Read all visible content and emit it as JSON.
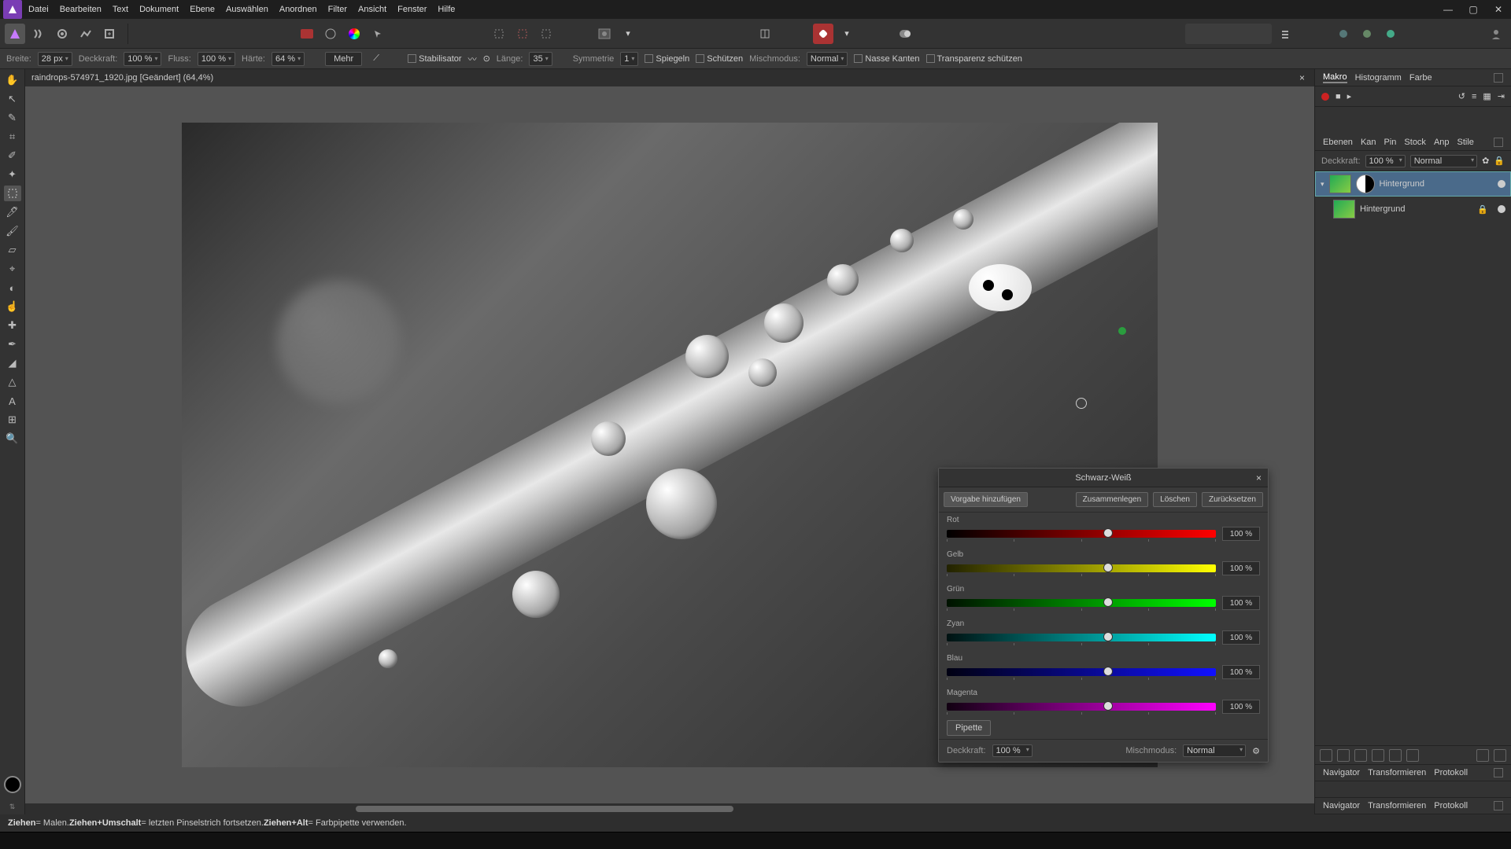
{
  "menu": [
    "Datei",
    "Bearbeiten",
    "Text",
    "Dokument",
    "Ebene",
    "Auswählen",
    "Anordnen",
    "Filter",
    "Ansicht",
    "Fenster",
    "Hilfe"
  ],
  "context": {
    "breite_lbl": "Breite:",
    "breite": "28 px",
    "deckkraft_lbl": "Deckkraft:",
    "deckkraft": "100 %",
    "fluss_lbl": "Fluss:",
    "fluss": "100 %",
    "haerte_lbl": "Härte:",
    "haerte": "64 %",
    "mehr": "Mehr",
    "stabi": "Stabilisator",
    "laenge_lbl": "Länge:",
    "laenge": "35",
    "sym_lbl": "Symmetrie",
    "sym": "1",
    "spiegeln": "Spiegeln",
    "schuetzen": "Schützen",
    "misch_lbl": "Mischmodus:",
    "misch": "Normal",
    "nasse": "Nasse Kanten",
    "trans": "Transparenz schützen"
  },
  "tab": "raindrops-574971_1920.jpg [Geändert] (64,4%)",
  "right": {
    "tabs1": [
      "Makro",
      "Histogramm",
      "Farbe"
    ],
    "tabs2": [
      "Ebenen",
      "Kan",
      "Pin",
      "Stock",
      "Anp",
      "Stile"
    ],
    "deck_lbl": "Deckkraft:",
    "deck": "100 %",
    "blend": "Normal",
    "layer1": "Hintergrund",
    "layer2": "Hintergrund",
    "tabs3": [
      "Navigator",
      "Transformieren",
      "Protokoll"
    ],
    "tabs4": [
      "Navigator",
      "Transformieren",
      "Protokoll"
    ]
  },
  "bw": {
    "title": "Schwarz-Weiß",
    "btn_add": "Vorgabe hinzufügen",
    "btn_merge": "Zusammenlegen",
    "btn_del": "Löschen",
    "btn_reset": "Zurücksetzen",
    "rot": "Rot",
    "gelb": "Gelb",
    "gruen": "Grün",
    "zyan": "Zyan",
    "blau": "Blau",
    "magenta": "Magenta",
    "val": "100 %",
    "pipette": "Pipette",
    "deck_lbl": "Deckkraft:",
    "deck": "100 %",
    "misch_lbl": "Mischmodus:",
    "misch": "Normal"
  },
  "footer": {
    "k1": "Ziehen",
    "t1": " = Malen. ",
    "k2": "Ziehen+Umschalt",
    "t2": " = letzten Pinselstrich fortsetzen. ",
    "k3": "Ziehen+Alt",
    "t3": " = Farbpipette verwenden."
  }
}
